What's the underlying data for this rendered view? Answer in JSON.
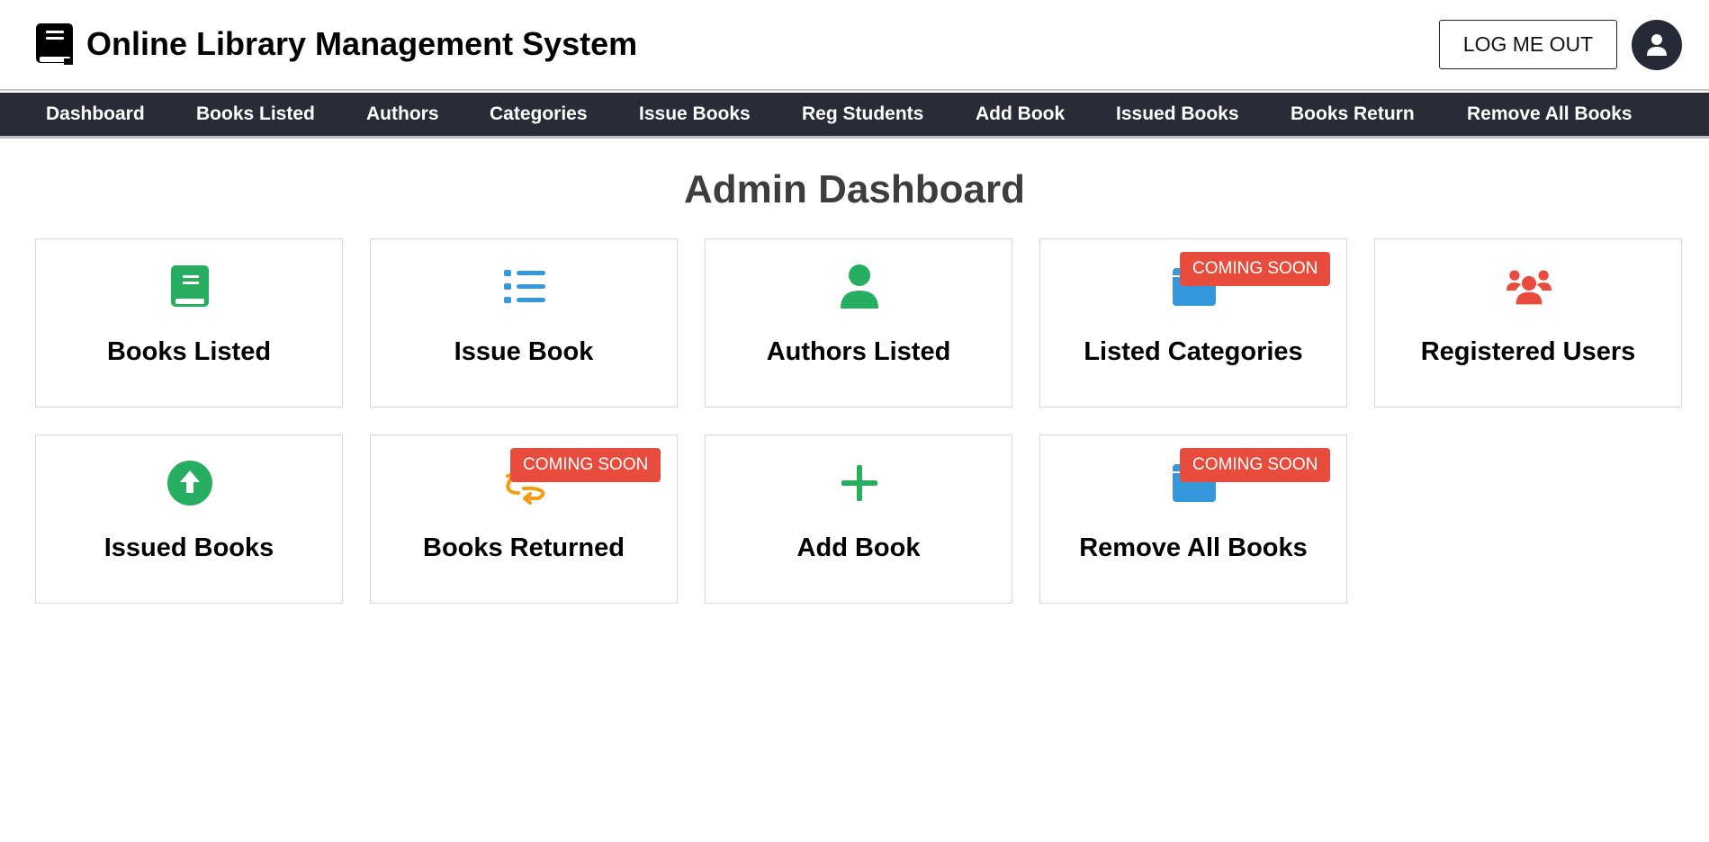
{
  "header": {
    "title": "Online Library Management System",
    "logo_icon": "book-icon",
    "logout_label": "LOG ME OUT",
    "avatar_icon": "user-icon"
  },
  "nav": {
    "items": [
      {
        "label": "Dashboard"
      },
      {
        "label": "Books Listed"
      },
      {
        "label": "Authors"
      },
      {
        "label": "Categories"
      },
      {
        "label": "Issue Books"
      },
      {
        "label": "Reg Students"
      },
      {
        "label": "Add Book"
      },
      {
        "label": "Issued Books"
      },
      {
        "label": "Books Return"
      },
      {
        "label": "Remove All Books"
      }
    ]
  },
  "main": {
    "title": "Admin Dashboard",
    "cards": [
      {
        "label": "Books Listed",
        "icon": "book-icon",
        "color": "#27ae60",
        "badge": ""
      },
      {
        "label": "Issue Book",
        "icon": "list-icon",
        "color": "#3498db",
        "badge": ""
      },
      {
        "label": "Authors Listed",
        "icon": "user-icon",
        "color": "#27ae60",
        "badge": ""
      },
      {
        "label": "Listed Categories",
        "icon": "folder-icon",
        "color": "#3498db",
        "badge": "COMING SOON"
      },
      {
        "label": "Registered Users",
        "icon": "users-icon",
        "color": "#e74c3c",
        "badge": ""
      },
      {
        "label": "Issued Books",
        "icon": "upload-circle-icon",
        "color": "#27ae60",
        "badge": ""
      },
      {
        "label": "Books Returned",
        "icon": "return-arrows-icon",
        "color": "#f39c12",
        "badge": "COMING SOON"
      },
      {
        "label": "Add Book",
        "icon": "plus-icon",
        "color": "#27ae60",
        "badge": ""
      },
      {
        "label": "Remove All Books",
        "icon": "folder-icon",
        "color": "#3498db",
        "badge": "COMING SOON"
      }
    ]
  },
  "colors": {
    "navbar_bg": "#292b36",
    "badge_bg": "#e74c3c",
    "green": "#27ae60",
    "blue": "#3498db",
    "red": "#e74c3c",
    "orange": "#f39c12"
  }
}
